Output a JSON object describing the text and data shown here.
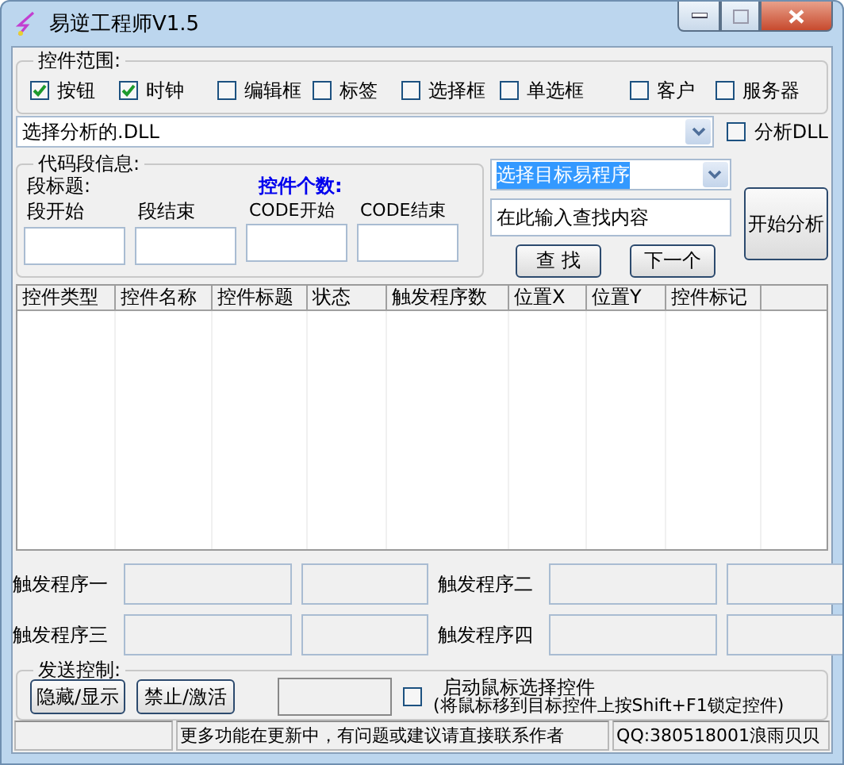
{
  "window": {
    "title": "易逆工程师V1.5"
  },
  "control_scope": {
    "title": "控件范围:",
    "options": [
      {
        "label": "按钮",
        "checked": true
      },
      {
        "label": "时钟",
        "checked": true
      },
      {
        "label": "编辑框",
        "checked": false
      },
      {
        "label": "标签",
        "checked": false
      },
      {
        "label": "选择框",
        "checked": false
      },
      {
        "label": "单选框",
        "checked": false
      },
      {
        "label": "客户",
        "checked": false
      },
      {
        "label": "服务器",
        "checked": false
      }
    ]
  },
  "dll_select": {
    "value": "选择分析的.DLL"
  },
  "analyze_dll": {
    "label": "分析DLL",
    "checked": false
  },
  "code_info": {
    "title": "代码段信息:",
    "segment_title": "段标题:",
    "count_label": "控件个数:",
    "fields": [
      {
        "label": "段开始"
      },
      {
        "label": "段结束"
      },
      {
        "label": "CODE开始"
      },
      {
        "label": "CODE结束"
      }
    ]
  },
  "target_select": {
    "value": "选择目标易程序"
  },
  "search": {
    "value": "在此输入查找内容"
  },
  "find_buttons": [
    "查 找",
    "下一个"
  ],
  "start_button": "开始分析",
  "table": {
    "columns": [
      "控件类型",
      "控件名称",
      "控件标题",
      "状态",
      "触发程序数",
      "位置X",
      "位置Y",
      "控件标记"
    ]
  },
  "triggers": [
    {
      "label": "触发程序一"
    },
    {
      "label": "触发程序二"
    },
    {
      "label": "触发程序三"
    },
    {
      "label": "触发程序四"
    }
  ],
  "send_control": {
    "title": "发送控制:",
    "buttons": [
      "隐藏/显示",
      "禁止/激活"
    ],
    "mouse_select": {
      "label": "启动鼠标选择控件",
      "checked": false
    },
    "hint": "(将鼠标移到目标控件上按Shift+F1锁定控件)"
  },
  "status_bar": [
    "更多功能在更新中，有问题或建议请直接联系作者",
    "QQ:380518001浪雨贝贝"
  ]
}
